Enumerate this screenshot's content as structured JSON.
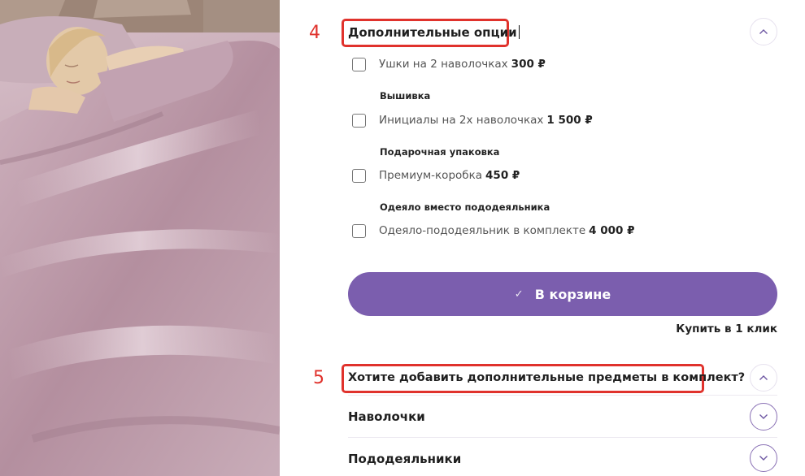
{
  "photo": {
    "alt": "woman sleeping under lilac satin bedding"
  },
  "annotations": {
    "step4": "4",
    "step5": "5"
  },
  "section_options": {
    "title": "Дополнительные опции",
    "items": [
      {
        "label": "Ушки на 2 наволочках",
        "price": "300 ₽"
      },
      {
        "label": "Инициалы на 2х наволочках",
        "price": "1 500 ₽"
      },
      {
        "label": "Премиум-коробка",
        "price": "450 ₽"
      },
      {
        "label": "Одеяло-пододеяльник в комплекте",
        "price": "4 000 ₽"
      }
    ],
    "groups": [
      "Вышивка",
      "Подарочная упаковка",
      "Одеяло вместо пододеяльника"
    ]
  },
  "cart": {
    "button_label": "В корзине",
    "one_click": "Купить в 1 клик"
  },
  "section_extra": {
    "title": "Хотите добавить дополнительные предметы в комплект?",
    "items": [
      "Наволочки",
      "Пододеяльники"
    ]
  },
  "colors": {
    "accent": "#7b5eae",
    "highlight": "#e0322c"
  }
}
